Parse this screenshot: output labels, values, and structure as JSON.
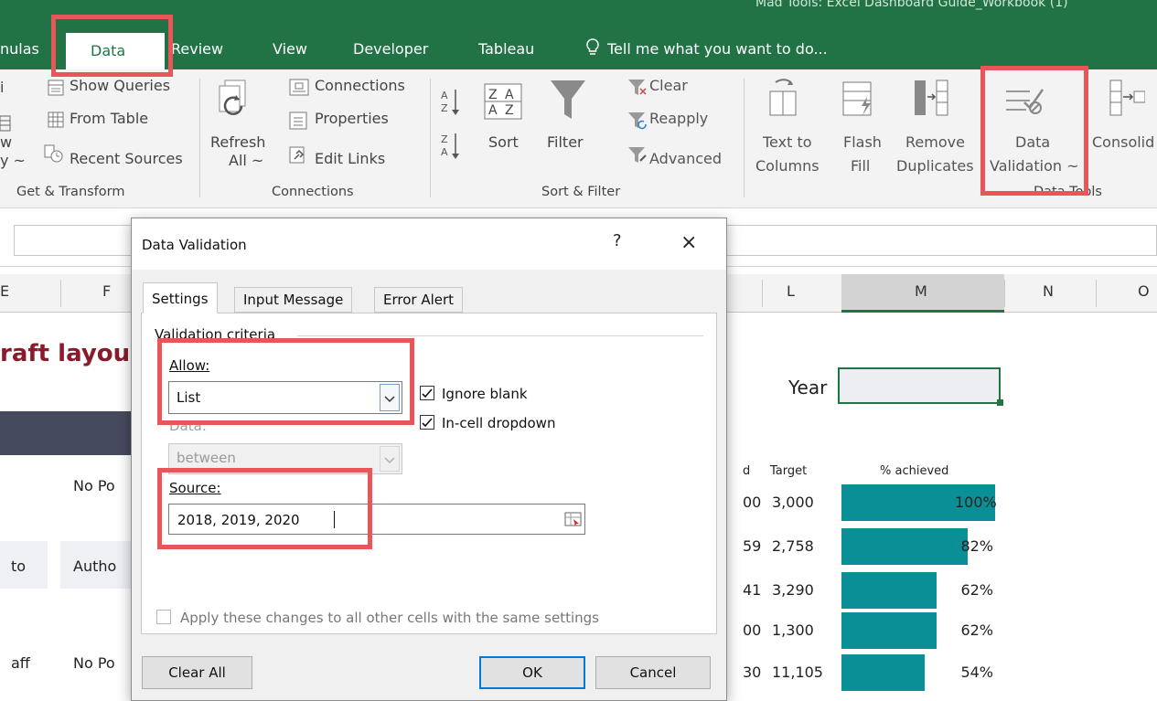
{
  "titlebar": {
    "file_title": "Mad Tools: Excel Dashboard Guide_Workbook (1)"
  },
  "ribbon_tabs": [
    "nulas",
    "Data",
    "Review",
    "View",
    "Developer",
    "Tableau"
  ],
  "tell_me": "Tell me what you want to do...",
  "ribbon": {
    "get_transform": {
      "label": "Get & Transform",
      "partial1": "i",
      "partial2": "w",
      "partial3": "y ~",
      "show_queries": "Show Queries",
      "from_table": "From Table",
      "recent_sources": "Recent Sources"
    },
    "connections": {
      "label": "Connections",
      "refresh": "Refresh",
      "refresh_all": "All ~",
      "connections": "Connections",
      "properties": "Properties",
      "edit_links": "Edit Links"
    },
    "sort_filter": {
      "label": "Sort & Filter",
      "sort": "Sort",
      "filter": "Filter",
      "clear": "Clear",
      "reapply": "Reapply",
      "advanced": "Advanced"
    },
    "data_tools": {
      "label": "Data Tools",
      "text_to": "Text to",
      "columns": "Columns",
      "flash": "Flash",
      "fill": "Fill",
      "remove": "Remove",
      "duplicates": "Duplicates",
      "data": "Data",
      "validation": "Validation ~",
      "consolidate": "Consolid"
    }
  },
  "columns": [
    "E",
    "F",
    "L",
    "M",
    "N",
    "O"
  ],
  "sheet": {
    "title_fragment": "raft layou",
    "year_label": "Year",
    "cells": {
      "no_po_1": "No Po",
      "to": "to",
      "autho": "Autho",
      "aff": "aff",
      "no_po_2": "No Po",
      "col_k_header": "d"
    },
    "table_headers": {
      "target": "Target",
      "pct": "% achieved"
    },
    "rows": [
      {
        "k": "00",
        "target": "3,000",
        "pct": "100%",
        "pct_value": 100
      },
      {
        "k": "59",
        "target": "2,758",
        "pct": "82%",
        "pct_value": 82
      },
      {
        "k": "41",
        "target": "3,290",
        "pct": "62%",
        "pct_value": 62
      },
      {
        "k": "00",
        "target": "1,300",
        "pct": "62%",
        "pct_value": 62
      },
      {
        "k": "30",
        "target": "11,105",
        "pct": "54%",
        "pct_value": 54
      }
    ]
  },
  "dialog": {
    "title": "Data Validation",
    "help": "?",
    "close": "×",
    "tabs": [
      "Settings",
      "Input Message",
      "Error Alert"
    ],
    "criteria_label": "Validation criteria",
    "allow_label": "Allow:",
    "allow_value": "List",
    "ignore_blank": "Ignore blank",
    "in_cell_dropdown": "In-cell dropdown",
    "data_label": "Data:",
    "data_value": "between",
    "source_label": "Source:",
    "source_value": "2018, 2019, 2020",
    "apply_all": "Apply these changes to all other cells with the same settings",
    "buttons": {
      "clear_all": "Clear All",
      "ok": "OK",
      "cancel": "Cancel"
    }
  },
  "colors": {
    "excel_green": "#217346",
    "bar_teal": "#0b8f96",
    "highlight_red": "#e8565a",
    "title_red": "#8b1a2b"
  }
}
